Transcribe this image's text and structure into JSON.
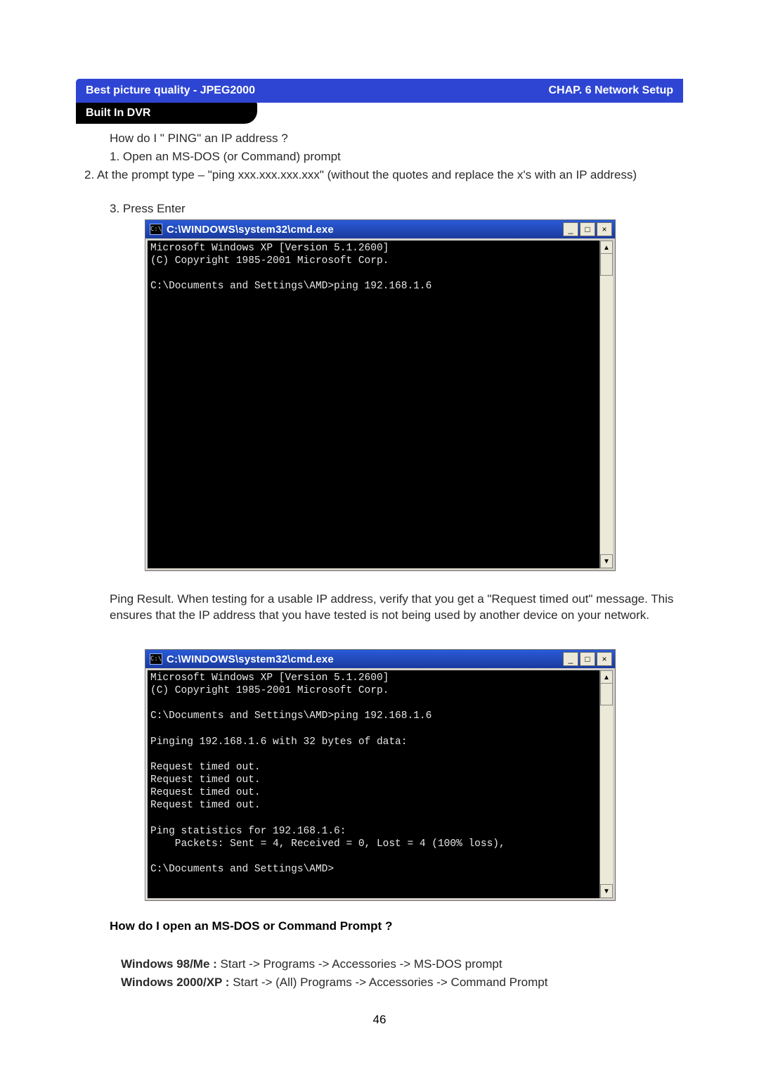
{
  "header": {
    "left": "Best picture quality - JPEG2000",
    "right": "CHAP. 6  Network Setup"
  },
  "tab": "Built In DVR",
  "text": {
    "q1": "How do I  \" PING\" an IP address ?",
    "s1": "1. Open an MS-DOS (or Command) prompt",
    "s2": "2. At the prompt type – \"ping xxx.xxx.xxx.xxx\" (without the quotes and replace the x's with an IP address)",
    "s3": "3. Press Enter",
    "desc": "Ping Result.  When testing for a usable IP address, verify that you get a \"Request timed out\" message. This ensures that the IP address that you have tested is not being used by another device on your network.",
    "q2": "How do I open an MS-DOS or Command Prompt ?",
    "os1_b": "Windows 98/Me : ",
    "os1_r": "Start -> Programs -> Accessories -> MS-DOS prompt",
    "os2_b": "Windows 2000/XP : ",
    "os2_r": "Start -> (All) Programs -> Accessories -> Command Prompt"
  },
  "term": {
    "icon": "C:\\",
    "title": "C:\\WINDOWS\\system32\\cmd.exe",
    "btn_min": "_",
    "btn_max": "□",
    "btn_close": "×",
    "arrow_up": "▲",
    "arrow_dn": "▼"
  },
  "console1": "Microsoft Windows XP [Version 5.1.2600]\n(C) Copyright 1985-2001 Microsoft Corp.\n\nC:\\Documents and Settings\\AMD>ping 192.168.1.6",
  "console2": "Microsoft Windows XP [Version 5.1.2600]\n(C) Copyright 1985-2001 Microsoft Corp.\n\nC:\\Documents and Settings\\AMD>ping 192.168.1.6\n\nPinging 192.168.1.6 with 32 bytes of data:\n\nRequest timed out.\nRequest timed out.\nRequest timed out.\nRequest timed out.\n\nPing statistics for 192.168.1.6:\n    Packets: Sent = 4, Received = 0, Lost = 4 (100% loss),\n\nC:\\Documents and Settings\\AMD>",
  "page_number": "46"
}
